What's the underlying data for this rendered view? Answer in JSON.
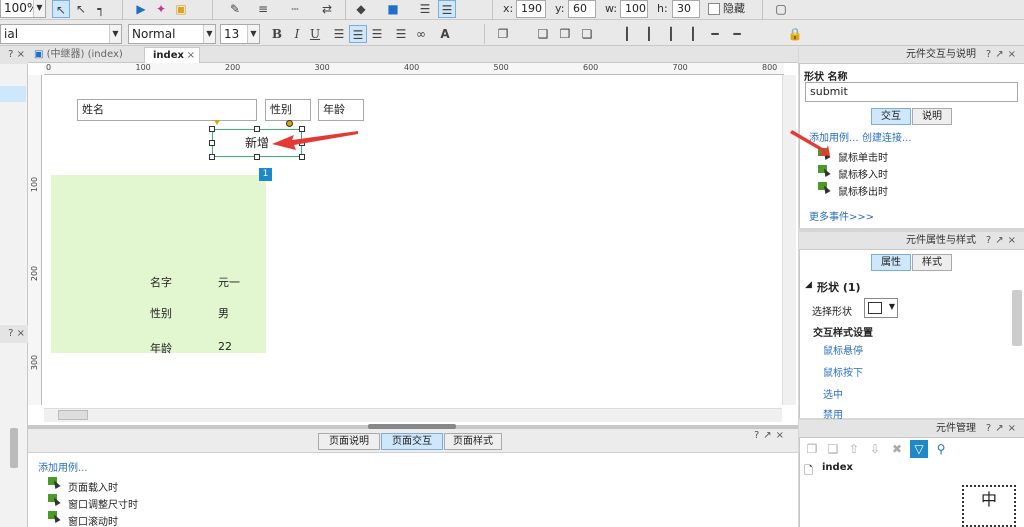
{
  "toolbar": {
    "zoom": "100%",
    "font_name": "ial",
    "style": "Normal",
    "font_size": "13",
    "pos": {
      "x_label": "x:",
      "x": "190",
      "y_label": "y:",
      "y": "60",
      "w_label": "w:",
      "w": "100",
      "h_label": "h:",
      "h": "30"
    },
    "hide_label": "隐藏"
  },
  "tabs": [
    {
      "label": "(中继器) (index)"
    },
    {
      "label": "index"
    }
  ],
  "ruler": {
    "h": [
      "0",
      "100",
      "200",
      "300",
      "400",
      "500",
      "600",
      "700",
      "800"
    ],
    "v": [
      "100",
      "200",
      "300"
    ]
  },
  "canvas": {
    "fields": [
      "姓名",
      "性别",
      "年龄"
    ],
    "submit_label": "新增",
    "repeater_badge": "1",
    "repeater_rows": [
      {
        "label": "名字",
        "value": "元一"
      },
      {
        "label": "性别",
        "value": "男"
      },
      {
        "label": "年龄",
        "value": "22"
      }
    ]
  },
  "bottom": {
    "tabs": [
      "页面说明",
      "页面交互",
      "页面样式"
    ],
    "add_case": "添加用例...",
    "events": [
      "页面载入时",
      "窗口调整尺寸时",
      "窗口滚动时"
    ]
  },
  "interactions_panel": {
    "title": "元件交互与说明",
    "name_label": "形状 名称",
    "name_value": "submit",
    "tabs": [
      "交互",
      "说明"
    ],
    "add_case": "添加用例...",
    "create_link": "创建连接...",
    "events": [
      "鼠标单击时",
      "鼠标移入时",
      "鼠标移出时"
    ],
    "more": "更多事件>>>"
  },
  "props_panel": {
    "title": "元件属性与样式",
    "tabs": [
      "属性",
      "样式"
    ],
    "section": "形状 (1)",
    "select_shape": "选择形状",
    "interaction_styles": "交互样式设置",
    "styles": [
      "鼠标悬停",
      "鼠标按下",
      "选中",
      "禁用"
    ]
  },
  "manager_panel": {
    "title": "元件管理",
    "item": "index",
    "thumb_char": "中"
  },
  "colors": {
    "repeater_bg": "#e2f7cf",
    "selection": "#3cb371",
    "arrow": "#e53935",
    "link": "#2a6fbf",
    "active_tab": "#cfe7fb"
  }
}
